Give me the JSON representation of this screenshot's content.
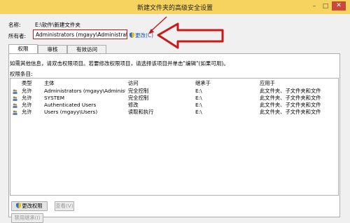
{
  "window": {
    "title": "新建文件夹的高级安全设置",
    "controls": [
      "–",
      "□",
      "✕"
    ]
  },
  "header": {
    "name_label": "名称:",
    "name_value": "E:\\软件\\新建文件夹",
    "owner_label": "所有者:",
    "owner_value": "Administrators (mgayy\\Administrators)",
    "change_owner_link": "更改(C)"
  },
  "tabs": [
    {
      "label": "权限"
    },
    {
      "label": "审核"
    },
    {
      "label": "有效访问"
    }
  ],
  "panel": {
    "info_text": "如需其他信息，请双击权限项目。若要修改权限项目，请选择该项目并单击\"编辑\"(如果可用)。",
    "entries_label": "权限条目:",
    "columns": [
      "类型",
      "主体",
      "访问",
      "继承于",
      "应用于"
    ],
    "rows": [
      {
        "type": "允许",
        "principal": "Administrators (mgayy\\Administr...",
        "access": "完全控制",
        "inherited": "E:\\",
        "applies": "此文件夹、子文件夹和文件"
      },
      {
        "type": "允许",
        "principal": "SYSTEM",
        "access": "完全控制",
        "inherited": "E:\\",
        "applies": "此文件夹、子文件夹和文件"
      },
      {
        "type": "允许",
        "principal": "Authenticated Users",
        "access": "修改",
        "inherited": "E:\\",
        "applies": "此文件夹、子文件夹和文件"
      },
      {
        "type": "允许",
        "principal": "Users (mgayy\\Users)",
        "access": "读取和执行",
        "inherited": "E:\\",
        "applies": "此文件夹、子文件夹和文件"
      }
    ]
  },
  "buttons": {
    "change_permissions": "更改权限",
    "view": "查看(V)",
    "disable_inheritance": "禁用继承(I)"
  },
  "colors": {
    "titlebar": "#f6d25e",
    "highlight_red": "#c81a1a"
  }
}
